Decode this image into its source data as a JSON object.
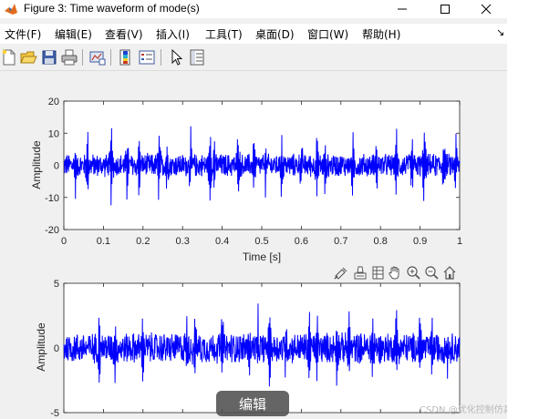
{
  "window": {
    "title": "Figure 3: Time waveform of mode(s)",
    "controls": [
      "minimize-icon",
      "maximize-icon",
      "close-icon"
    ]
  },
  "menubar": {
    "items": [
      {
        "label": "文件(F)"
      },
      {
        "label": "编辑(E)"
      },
      {
        "label": "查看(V)"
      },
      {
        "label": "插入(I)"
      },
      {
        "label": "工具(T)"
      },
      {
        "label": "桌面(D)"
      },
      {
        "label": "窗口(W)"
      },
      {
        "label": "帮助(H)"
      }
    ],
    "overflow_icon": "arrow-down-right-icon"
  },
  "toolbar": {
    "buttons": [
      "new-figure-icon",
      "open-file-icon",
      "save-icon",
      "print-icon",
      "link-plot-icon",
      "insert-colorbar-icon",
      "insert-legend-icon",
      "edit-plot-cursor-icon",
      "property-inspector-icon"
    ]
  },
  "axes_toolbar": {
    "buttons": [
      "brush-icon",
      "data-tips-icon",
      "restore-view-icon",
      "pan-hand-icon",
      "zoom-in-icon",
      "zoom-out-icon",
      "home-icon"
    ]
  },
  "colors": {
    "signal": "#0000ff",
    "axes_bg": "#ffffff",
    "figure_bg": "#f0f0f0"
  },
  "chart_data": [
    {
      "type": "line",
      "xlabel": "Time [s]",
      "ylabel": "Amplitude",
      "xlim": [
        0,
        1
      ],
      "ylim": [
        -20,
        20
      ],
      "x_ticks": [
        "0",
        "0.1",
        "0.2",
        "0.3",
        "0.4",
        "0.5",
        "0.6",
        "0.7",
        "0.8",
        "0.9",
        "1"
      ],
      "y_ticks": [
        "-20",
        "-10",
        "0",
        "10",
        "20"
      ],
      "series": [
        {
          "color": "#0000ff",
          "noise_band": [
            -4,
            4
          ],
          "spike_times": [
            0.03,
            0.06,
            0.12,
            0.16,
            0.19,
            0.24,
            0.26,
            0.32,
            0.37,
            0.38,
            0.44,
            0.48,
            0.51,
            0.55,
            0.6,
            0.64,
            0.66,
            0.73,
            0.79,
            0.84,
            0.88,
            0.91,
            0.96,
            0.99
          ],
          "spike_peaks": [
            10,
            12,
            13,
            12,
            10,
            12,
            11,
            13,
            12,
            10,
            13,
            14,
            10,
            12,
            11,
            13,
            10,
            12,
            11,
            13,
            10,
            16,
            12,
            11
          ],
          "spike_troughs": [
            -13,
            -11,
            -14,
            -12,
            -11,
            -13,
            -12,
            -12,
            -13,
            -11,
            -12,
            -15,
            -11,
            -13,
            -10,
            -12,
            -11,
            -13,
            -12,
            -11,
            -10,
            -16,
            -12,
            -11
          ]
        }
      ]
    },
    {
      "type": "line",
      "xlabel": "",
      "ylabel": "Amplitude",
      "xlim": [
        0,
        1
      ],
      "ylim": [
        -5,
        5
      ],
      "y_ticks": [
        "-5",
        "0",
        "5"
      ],
      "series": [
        {
          "color": "#0000ff",
          "noise_band": [
            -1.3,
            1.3
          ],
          "spike_times": [
            0.09,
            0.13,
            0.2,
            0.31,
            0.33,
            0.4,
            0.47,
            0.49,
            0.52,
            0.56,
            0.62,
            0.64,
            0.69,
            0.72,
            0.78,
            0.84,
            0.9,
            0.93,
            0.97
          ],
          "spike_peaks": [
            3.8,
            2.6,
            3.1,
            3.6,
            2.4,
            4.2,
            2.5,
            3.3,
            3.9,
            2.8,
            3.6,
            2.6,
            3.1,
            4.2,
            3.3,
            3.5,
            3.7,
            2.6,
            2.4
          ],
          "spike_troughs": [
            -3.3,
            -2.9,
            -3.2,
            -2.9,
            -2.3,
            -3.4,
            -2.6,
            -3.1,
            -3.6,
            -2.5,
            -3.3,
            -2.5,
            -3.0,
            -3.4,
            -3.0,
            -3.2,
            -2.5,
            -2.6,
            -2.3
          ]
        }
      ]
    }
  ],
  "overlay": {
    "edit_popup": "编辑",
    "watermark": "CSDN @优化控制仿真模型"
  }
}
